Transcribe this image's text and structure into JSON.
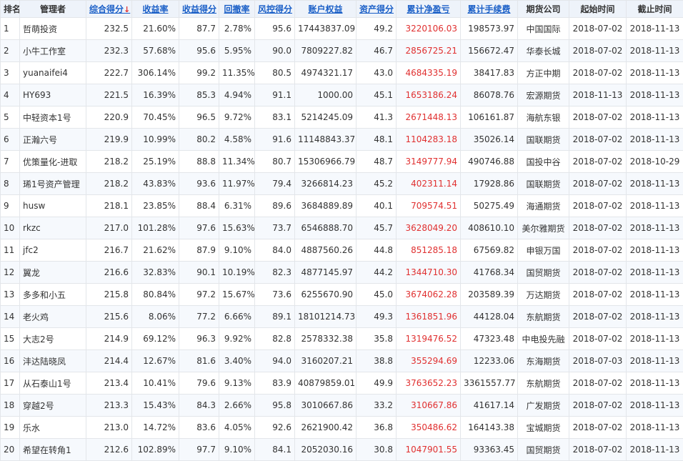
{
  "headers": [
    {
      "label": "排名",
      "sortable": false
    },
    {
      "label": "管理者",
      "sortable": false
    },
    {
      "label": "综合得分",
      "sortable": true,
      "arrow": "↓"
    },
    {
      "label": "收益率",
      "sortable": true
    },
    {
      "label": "收益得分",
      "sortable": true
    },
    {
      "label": "回撤率",
      "sortable": true
    },
    {
      "label": "风控得分",
      "sortable": true
    },
    {
      "label": "账户权益",
      "sortable": true
    },
    {
      "label": "资产得分",
      "sortable": true
    },
    {
      "label": "累计净盈亏",
      "sortable": true
    },
    {
      "label": "累计手续费",
      "sortable": true
    },
    {
      "label": "期货公司",
      "sortable": false
    },
    {
      "label": "起始时间",
      "sortable": false
    },
    {
      "label": "截止时间",
      "sortable": false
    }
  ],
  "colors": {
    "link": "#1a5fc7",
    "profit": "#e03030",
    "header_bg": "#eef3fa"
  },
  "rows": [
    [
      "1",
      "哲萌投资",
      "232.5",
      "21.60%",
      "87.7",
      "2.78%",
      "95.6",
      "17443837.09",
      "49.2",
      "3220106.03",
      "198573.97",
      "中国国际",
      "2018-07-02",
      "2018-11-13"
    ],
    [
      "2",
      "小牛工作室",
      "232.3",
      "57.68%",
      "95.6",
      "5.95%",
      "90.0",
      "7809227.82",
      "46.7",
      "2856725.21",
      "156672.47",
      "华泰长城",
      "2018-07-02",
      "2018-11-13"
    ],
    [
      "3",
      "yuanaifei4",
      "222.7",
      "306.14%",
      "99.2",
      "11.35%",
      "80.5",
      "4974321.17",
      "43.0",
      "4684335.19",
      "38417.83",
      "方正中期",
      "2018-07-02",
      "2018-11-13"
    ],
    [
      "4",
      "HY693",
      "221.5",
      "16.39%",
      "85.3",
      "4.94%",
      "91.1",
      "1000.00",
      "45.1",
      "1653186.24",
      "86078.76",
      "宏源期货",
      "2018-11-13",
      "2018-11-13"
    ],
    [
      "5",
      "中轻资本1号",
      "220.9",
      "70.45%",
      "96.5",
      "9.72%",
      "83.1",
      "5214245.09",
      "41.3",
      "2671448.13",
      "106161.87",
      "海航东银",
      "2018-07-02",
      "2018-11-13"
    ],
    [
      "6",
      "正瀚六号",
      "219.9",
      "10.99%",
      "80.2",
      "4.58%",
      "91.6",
      "11148843.37",
      "48.1",
      "1104283.18",
      "35026.14",
      "国联期货",
      "2018-07-02",
      "2018-11-13"
    ],
    [
      "7",
      "优策量化-进取",
      "218.2",
      "25.19%",
      "88.8",
      "11.34%",
      "80.7",
      "15306966.79",
      "48.7",
      "3149777.94",
      "490746.88",
      "国投中谷",
      "2018-07-02",
      "2018-10-29"
    ],
    [
      "8",
      "琋1号资产管理",
      "218.2",
      "43.83%",
      "93.6",
      "11.97%",
      "79.4",
      "3266814.23",
      "45.2",
      "402311.14",
      "17928.86",
      "国联期货",
      "2018-07-02",
      "2018-11-13"
    ],
    [
      "9",
      "husw",
      "218.1",
      "23.85%",
      "88.4",
      "6.31%",
      "89.6",
      "3684889.89",
      "40.1",
      "709574.51",
      "50275.49",
      "海通期货",
      "2018-07-02",
      "2018-11-13"
    ],
    [
      "10",
      "rkzc",
      "217.0",
      "101.28%",
      "97.6",
      "15.63%",
      "73.7",
      "6546888.70",
      "45.7",
      "3628049.20",
      "408610.10",
      "美尔雅期货",
      "2018-07-02",
      "2018-11-13"
    ],
    [
      "11",
      "jfc2",
      "216.7",
      "21.62%",
      "87.9",
      "9.10%",
      "84.0",
      "4887560.26",
      "44.8",
      "851285.18",
      "67569.82",
      "申银万国",
      "2018-07-02",
      "2018-11-13"
    ],
    [
      "12",
      "翼龙",
      "216.6",
      "32.83%",
      "90.1",
      "10.19%",
      "82.3",
      "4877145.97",
      "44.2",
      "1344710.30",
      "41768.34",
      "国贸期货",
      "2018-07-02",
      "2018-11-13"
    ],
    [
      "13",
      "多多和小五",
      "215.8",
      "80.84%",
      "97.2",
      "15.67%",
      "73.6",
      "6255670.90",
      "45.0",
      "3674062.28",
      "203589.39",
      "万达期货",
      "2018-07-02",
      "2018-11-13"
    ],
    [
      "14",
      "老火鸡",
      "215.6",
      "8.06%",
      "77.2",
      "6.66%",
      "89.1",
      "18101214.73",
      "49.3",
      "1361851.96",
      "44128.04",
      "东航期货",
      "2018-07-02",
      "2018-11-13"
    ],
    [
      "15",
      "大志2号",
      "214.9",
      "69.12%",
      "96.3",
      "9.92%",
      "82.8",
      "2578332.38",
      "35.8",
      "1319476.52",
      "47323.48",
      "中电投先融",
      "2018-07-02",
      "2018-11-13"
    ],
    [
      "16",
      "沣达陆晓凤",
      "214.4",
      "12.67%",
      "81.6",
      "3.40%",
      "94.0",
      "3160207.21",
      "38.8",
      "355294.69",
      "12233.06",
      "东海期货",
      "2018-07-03",
      "2018-11-13"
    ],
    [
      "17",
      "从石泰山1号",
      "213.4",
      "10.41%",
      "79.6",
      "9.13%",
      "83.9",
      "40879859.01",
      "49.9",
      "3763652.23",
      "3361557.77",
      "东航期货",
      "2018-07-02",
      "2018-11-13"
    ],
    [
      "18",
      "穿越2号",
      "213.3",
      "15.43%",
      "84.3",
      "2.66%",
      "95.8",
      "3010667.86",
      "33.2",
      "310667.86",
      "41617.14",
      "广发期货",
      "2018-07-02",
      "2018-11-13"
    ],
    [
      "19",
      "乐水",
      "213.0",
      "14.72%",
      "83.6",
      "4.05%",
      "92.6",
      "2621900.42",
      "36.8",
      "350486.62",
      "164143.38",
      "宝城期货",
      "2018-07-02",
      "2018-11-13"
    ],
    [
      "20",
      "希望在转角1",
      "212.6",
      "102.89%",
      "97.7",
      "9.10%",
      "84.1",
      "2052030.16",
      "30.8",
      "1047901.55",
      "93363.45",
      "国贸期货",
      "2018-07-02",
      "2018-11-13"
    ]
  ]
}
